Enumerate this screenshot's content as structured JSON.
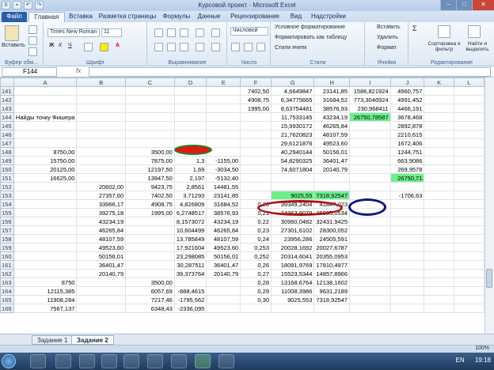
{
  "app": {
    "title": "Курсовой проект - Microsoft Excel",
    "qat_buttons": [
      "save",
      "undo",
      "redo"
    ]
  },
  "ribbon_tabs": [
    "Файл",
    "Главная",
    "Вставка",
    "Разметка страницы",
    "Формулы",
    "Данные",
    "Рецензирование",
    "Вид",
    "Надстройки"
  ],
  "ribbon": {
    "paste_label": "Вставить",
    "clipboard_label": "Буфер обм...",
    "font_name": "Times New Roman",
    "font_size": "11",
    "font_group_label": "Шрифт",
    "align_group_label": "Выравнивание",
    "number_format": "Числовой",
    "number_group_label": "Число",
    "styles": [
      "Условное форматирование",
      "Форматировать как таблицу",
      "Стили ячеек"
    ],
    "styles_group_label": "Стили",
    "cells": [
      "Вставить",
      "Удалить",
      "Формат"
    ],
    "cells_group_label": "Ячейки",
    "edit": [
      "Сортировка и фильтр",
      "Найти и выделить"
    ],
    "edit_group_label": "Редактирование"
  },
  "formula_bar": {
    "name_box": "F144",
    "fx": "fx",
    "value": ""
  },
  "columns": [
    "",
    "A",
    "B",
    "C",
    "D",
    "E",
    "F",
    "G",
    "H",
    "I",
    "J",
    "K",
    "L"
  ],
  "rows": [
    {
      "n": "141",
      "cells": [
        "",
        "",
        "",
        "",
        "",
        "7402,50",
        "4,6649847",
        "23141,85",
        "1586,821924",
        "4960,757",
        "",
        ""
      ]
    },
    {
      "n": "142",
      "cells": [
        "",
        "",
        "",
        "",
        "",
        "4908,75",
        "6,34775665",
        "31684,52",
        "773,3046924",
        "4991,452",
        "",
        ""
      ]
    },
    {
      "n": "143",
      "cells": [
        "",
        "",
        "",
        "",
        "",
        "1995,00",
        "8,63754481",
        "38576,93",
        "230,968411",
        "4466,191",
        "",
        ""
      ]
    },
    {
      "n": "144",
      "cells": [
        "Найды точку Фишера",
        "",
        "",
        "",
        "",
        "",
        "11,7533145",
        "43234,19",
        "26750,78587",
        "3678,468",
        "",
        ""
      ]
    },
    {
      "n": "145",
      "cells": [
        "",
        "",
        "",
        "",
        "",
        "",
        "15,9930172",
        "46265,84",
        "",
        "2892,878",
        "",
        ""
      ]
    },
    {
      "n": "146",
      "cells": [
        "",
        "",
        "",
        "",
        "",
        "",
        "21,7620823",
        "48107,59",
        "",
        "2210,615",
        "",
        ""
      ]
    },
    {
      "n": "147",
      "cells": [
        "",
        "",
        "",
        "",
        "",
        "",
        "29,6121876",
        "49523,60",
        "",
        "1672,406",
        "",
        ""
      ]
    },
    {
      "n": "148",
      "cells": [
        "8750,00",
        "",
        "3500,00",
        "1",
        "",
        "",
        "40,2940144",
        "50156,01",
        "",
        "1244,751",
        "",
        ""
      ]
    },
    {
      "n": "149",
      "cells": [
        "15750,00",
        "",
        "7875,00",
        "1,3",
        "-1155,00",
        "",
        "54,8290325",
        "36401,47",
        "",
        "663,9086",
        "",
        ""
      ]
    },
    {
      "n": "150",
      "cells": [
        "20125,00",
        "",
        "12197,50",
        "1,69",
        "-3034,50",
        "",
        "74,6071804",
        "20140,79",
        "",
        "269,9578",
        "",
        ""
      ]
    },
    {
      "n": "151",
      "cells": [
        "16625,00",
        "",
        "13947,50",
        "2,197",
        "-5132,40",
        "",
        "",
        "",
        "",
        "26750,71",
        "",
        ""
      ]
    },
    {
      "n": "152",
      "cells": [
        "",
        "20602,00",
        "9423,75",
        "2,8561",
        "14481,55",
        "",
        "",
        "",
        "",
        "",
        "",
        ""
      ]
    },
    {
      "n": "153",
      "cells": [
        "",
        "27357,60",
        "7402,50",
        "3,71293",
        "23141,85",
        "",
        "9025,55",
        "7318,92547",
        "",
        "-1706,63",
        "",
        ""
      ]
    },
    {
      "n": "154",
      "cells": [
        "",
        "33966,17",
        "4908,75",
        "4,826809",
        "31684,52",
        "0,20",
        "39349,2404",
        "41847,023",
        "",
        "",
        "",
        ""
      ]
    },
    {
      "n": "155",
      "cells": [
        "",
        "39275,18",
        "1995,00",
        "6,2748517",
        "38576,93",
        "0,21",
        "34963,9079",
        "36935,0534",
        "",
        "",
        "",
        ""
      ]
    },
    {
      "n": "156",
      "cells": [
        "",
        "43234,19",
        "",
        "8,1573072",
        "43234,19",
        "0,22",
        "30960,0482",
        "32431,9425",
        "",
        "",
        "",
        ""
      ]
    },
    {
      "n": "157",
      "cells": [
        "",
        "46265,84",
        "",
        "10,604499",
        "46265,84",
        "0,23",
        "27301,6102",
        "28300,052",
        "",
        "",
        "",
        ""
      ]
    },
    {
      "n": "158",
      "cells": [
        "",
        "48107,59",
        "",
        "13,785849",
        "48107,59",
        "0,24",
        "23956,286",
        "24505,591",
        "",
        "",
        "",
        ""
      ]
    },
    {
      "n": "159",
      "cells": [
        "",
        "49523,60",
        "",
        "17,921604",
        "49523,60",
        "0,253",
        "20028,1692",
        "20027,6787",
        "",
        "",
        "",
        ""
      ]
    },
    {
      "n": "160",
      "cells": [
        "",
        "50156,01",
        "",
        "23,298085",
        "50156,01",
        "0,252",
        "20314,6041",
        "20355,0953",
        "",
        "",
        "",
        ""
      ]
    },
    {
      "n": "161",
      "cells": [
        "",
        "36401,47",
        "",
        "30,287511",
        "36401,47",
        "0,26",
        "18091,9769",
        "17810,4977",
        "",
        "",
        "",
        ""
      ]
    },
    {
      "n": "162",
      "cells": [
        "",
        "20140,79",
        "",
        "39,373764",
        "20140,79",
        "0,27",
        "15523,5344",
        "14857,8966",
        "",
        "",
        "",
        ""
      ]
    },
    {
      "n": "163",
      "cells": [
        "8750",
        "",
        "3500,00",
        "",
        "",
        "0,28",
        "13168,6764",
        "12138,1602",
        "",
        "",
        "",
        ""
      ]
    },
    {
      "n": "164",
      "cells": [
        "12115,385",
        "",
        "6057,69",
        "-888,4615",
        "",
        "0,29",
        "11008,3986",
        "9631,2189",
        "",
        "",
        "",
        ""
      ]
    },
    {
      "n": "165",
      "cells": [
        "11908,284",
        "",
        "7217,46",
        "-1795,562",
        "",
        "0,30",
        "9025,553",
        "7318,92547",
        "",
        "",
        "",
        ""
      ]
    },
    {
      "n": "166",
      "cells": [
        "7567,137",
        "",
        "6348,43",
        "-2336,095",
        "",
        "",
        "",
        "",
        "",
        "",
        "",
        ""
      ]
    }
  ],
  "sheets": [
    "Задание 1",
    "Задание 2"
  ],
  "status": {
    "zoom": "100%"
  },
  "taskbar": {
    "lang": "EN",
    "time": "19:18"
  },
  "colors": {
    "highlight_green": "#6cf08c",
    "red_mark": "#e01818",
    "green_oval": "#1a8a1a",
    "red_oval": "#b01010",
    "blue_oval": "#0a1a80"
  }
}
